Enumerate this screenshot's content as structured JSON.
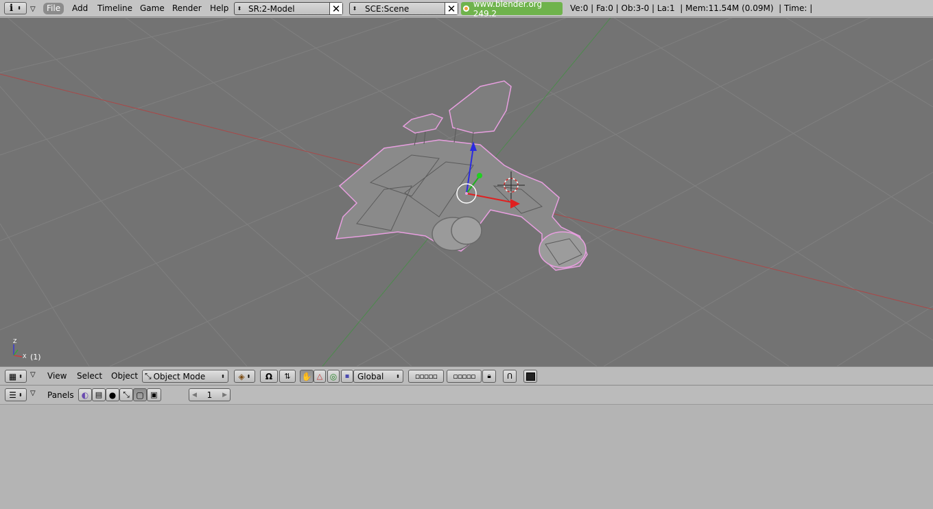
{
  "topbar": {
    "menus": [
      "File",
      "Add",
      "Timeline",
      "Game",
      "Render",
      "Help"
    ],
    "screen_field": "SR:2-Model",
    "scene_field": "SCE:Scene",
    "url": "www.blender.org 249.2",
    "stats": "Ve:0 | Fa:0 | Ob:3-0 | La:1  | Mem:11.54M (0.09M)  | Time: |"
  },
  "viewport": {
    "frame_label": "(1)",
    "axis_labels": {
      "z": "Z",
      "x": "X"
    }
  },
  "view3d_header": {
    "menus": [
      "View",
      "Select",
      "Object"
    ],
    "mode": "Object Mode",
    "orientation": "Global"
  },
  "buttons_header": {
    "panels_label": "Panels",
    "frame_value": "1"
  },
  "colors": {
    "viewport_bg": "#737373",
    "selection_outline": "#e89fe0",
    "x_axis": "#b33a3a",
    "y_axis": "#3a8a3a",
    "url_bg": "#6fb34c"
  }
}
